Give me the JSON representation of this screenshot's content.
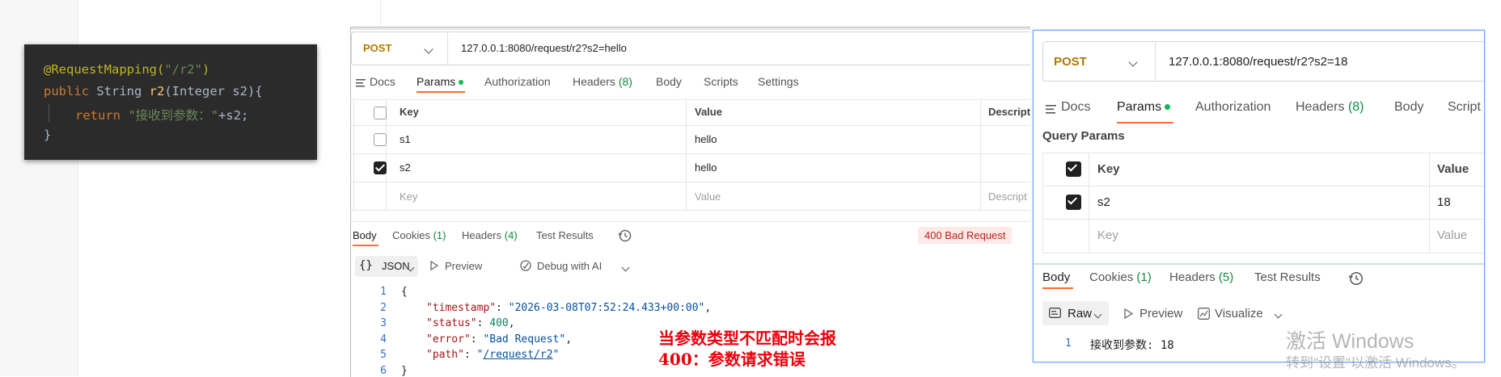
{
  "code_panel": {
    "annotation": "@RequestMapping(",
    "annotation_value": "\"/r2\"",
    "annotation_close": ")",
    "kw_public": "public",
    "type_string": " String ",
    "method_name": "r2",
    "params": "(Integer s2){",
    "kw_return": "return",
    "return_str": "\"接收到参数：\"",
    "return_tail": "+s2;",
    "close_brace": "}"
  },
  "window1": {
    "method": "POST",
    "url": "127.0.0.1:8080/request/r2?s2=hello",
    "tabs": [
      "Docs",
      "Params",
      "Authorization",
      "Headers",
      "Body",
      "Scripts",
      "Settings"
    ],
    "headers_count": "(8)",
    "table": {
      "col_key": "Key",
      "col_value": "Value",
      "col_desc": "Descript",
      "rows": [
        {
          "key": "s1",
          "value": "hello",
          "checked": false
        },
        {
          "key": "s2",
          "value": "hello",
          "checked": true
        }
      ],
      "placeholder_key": "Key",
      "placeholder_value": "Value",
      "placeholder_desc": "Descript"
    },
    "resp_tabs": {
      "body": "Body",
      "cookies": "Cookies",
      "cookies_count": "(1)",
      "headers": "Headers",
      "headers_count": "(4)",
      "tests": "Test Results"
    },
    "status": "400 Bad Request",
    "format": "JSON",
    "preview": "Preview",
    "debug": "Debug with AI",
    "json_lines": {
      "l1": "{",
      "k_timestamp": "\"timestamp\"",
      "v_timestamp": "\"2026-03-08T07:52:24.433+00:00\"",
      "k_status": "\"status\"",
      "v_status": "400",
      "k_error": "\"error\"",
      "v_error": "\"Bad Request\"",
      "k_path": "\"path\"",
      "v_path": "/request/r2",
      "l6": "}"
    },
    "line_numbers": [
      "1",
      "2",
      "3",
      "4",
      "5",
      "6"
    ]
  },
  "annotation_note": {
    "line1": "当参数类型不匹配时会报",
    "line2": "400：参数请求错误"
  },
  "window2": {
    "method": "POST",
    "url": "127.0.0.1:8080/request/r2?s2=18",
    "tabs": [
      "Docs",
      "Params",
      "Authorization",
      "Headers",
      "Body",
      "Script"
    ],
    "headers_count": "(8)",
    "query_params_title": "Query Params",
    "table": {
      "col_key": "Key",
      "col_value": "Value",
      "row_key": "s2",
      "row_value": "18",
      "placeholder_key": "Key",
      "placeholder_value": "Value"
    },
    "resp_tabs": {
      "body": "Body",
      "cookies": "Cookies",
      "cookies_count": "(1)",
      "headers": "Headers",
      "headers_count": "(5)",
      "tests": "Test Results"
    },
    "format": "Raw",
    "preview": "Preview",
    "visualize": "Visualize",
    "resp_line_no": "1",
    "resp_text": "接收到参数: 18"
  },
  "watermark": {
    "line1": "激活 Windows",
    "line2": "转到\"设置\"以激活 Windows。"
  },
  "colors": {
    "accent": "#ff6c37",
    "method": "#ad7a03",
    "error": "#e8000b",
    "count": "#0f8a3f"
  }
}
